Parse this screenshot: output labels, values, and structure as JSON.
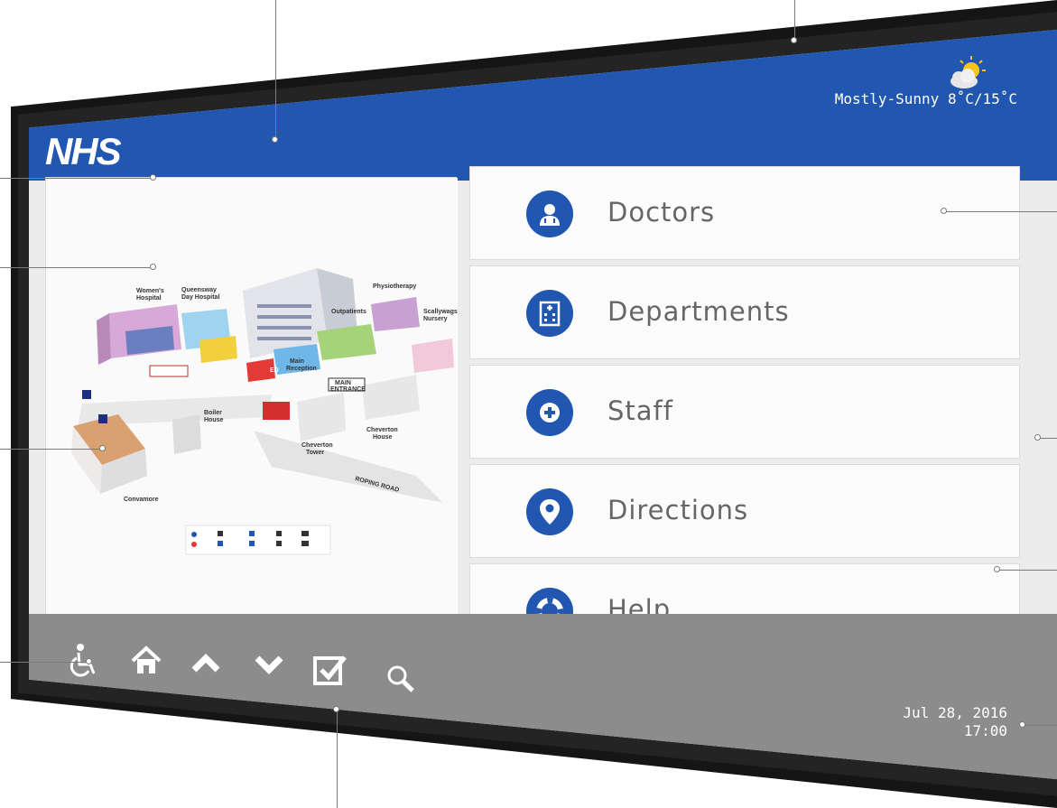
{
  "header": {
    "logo": "NHS"
  },
  "weather": {
    "condition": "Mostly-Sunny",
    "temps": "8˚C/15˚C",
    "icon": "sun-cloud-icon"
  },
  "map": {
    "labels": {
      "womens_hospital_1": "Women's",
      "womens_hospital_2": "Hospital",
      "queensway_1": "Queensway",
      "queensway_2": "Day Hospital",
      "physiotherapy": "Physiotherapy",
      "outpatients": "Outpatients",
      "scallywags_1": "Scallywags",
      "scallywags_2": "Nursery",
      "ed": "ED",
      "main_reception_1": "Main",
      "main_reception_2": "Reception",
      "main_entrance_1": "MAIN",
      "main_entrance_2": "ENTRANCE",
      "boiler_1": "Boiler",
      "boiler_2": "House",
      "cheverton_tower_1": "Cheverton",
      "cheverton_tower_2": "Tower",
      "cheverton_house_1": "Cheverton",
      "cheverton_house_2": "House",
      "road": "ROPING ROAD",
      "convamore": "Convamore"
    }
  },
  "menu": [
    {
      "label": "Doctors",
      "icon": "doctor-icon"
    },
    {
      "label": "Departments",
      "icon": "hospital-building-icon"
    },
    {
      "label": "Staff",
      "icon": "medical-cross-icon"
    },
    {
      "label": "Directions",
      "icon": "map-pin-icon"
    },
    {
      "label": "Help",
      "icon": "lifebuoy-icon"
    }
  ],
  "toolbar": [
    {
      "icon": "wheelchair-icon"
    },
    {
      "icon": "home-icon"
    },
    {
      "icon": "chevron-up-icon"
    },
    {
      "icon": "chevron-down-icon"
    },
    {
      "icon": "checkbox-icon"
    },
    {
      "icon": "search-icon"
    }
  ],
  "datetime": {
    "date": "Jul 28, 2016",
    "time": "17:00"
  },
  "colors": {
    "primary": "#2257b1",
    "footer": "#8c8c8c",
    "background": "#ececec"
  }
}
